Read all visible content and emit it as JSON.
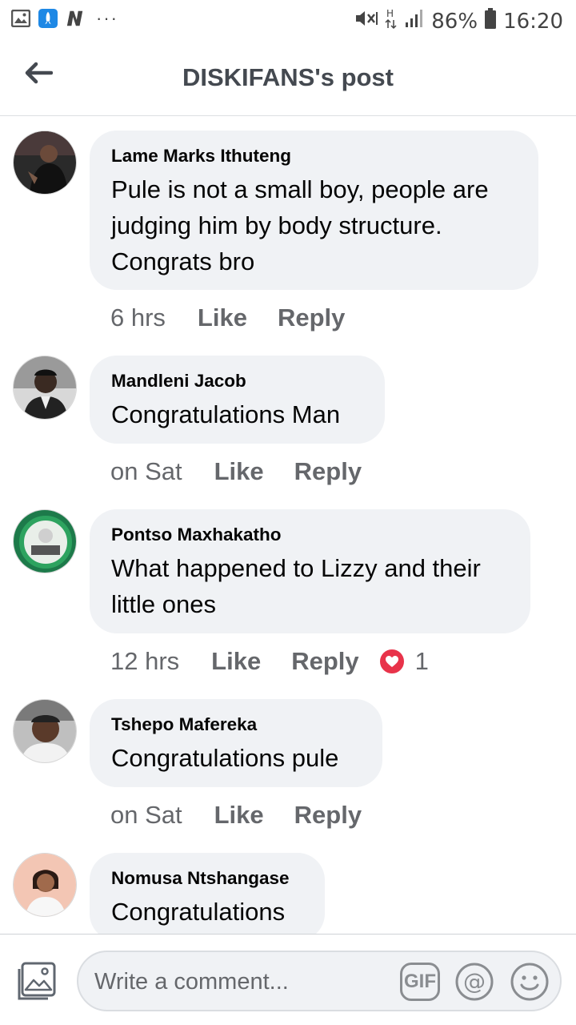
{
  "status_bar": {
    "left_icons": [
      "image-icon",
      "rocket-app-icon",
      "n-app-icon"
    ],
    "more": "···",
    "battery": "86%",
    "time": "16:20",
    "right_icons": [
      "mute-icon",
      "network-h-icon",
      "signal-icon",
      "battery-icon"
    ]
  },
  "header": {
    "title": "DISKIFANS's post",
    "back_icon": "arrow-left-icon"
  },
  "comments": [
    {
      "author": "Lame Marks Ithuteng",
      "text": "Pule is not a small boy, people are judging him by body structure. Congrats bro",
      "time": "6 hrs",
      "like": "Like",
      "reply": "Reply"
    },
    {
      "author": "Mandleni Jacob",
      "text": "Congratulations Man",
      "time": "on Sat",
      "like": "Like",
      "reply": "Reply"
    },
    {
      "author": "Pontso Maxhakatho",
      "text": "What happened to Lizzy and their little ones",
      "time": "12 hrs",
      "like": "Like",
      "reply": "Reply",
      "reaction": {
        "icon": "heart-icon",
        "count": "1",
        "color": "#e8334a"
      }
    },
    {
      "author": "Tshepo Mafereka",
      "text": "Congratulations pule",
      "time": "on Sat",
      "like": "Like",
      "reply": "Reply"
    },
    {
      "author": "Nomusa Ntshangase",
      "text": "Congratulations",
      "time": "",
      "like": "",
      "reply": ""
    }
  ],
  "composer": {
    "placeholder": "Write a comment...",
    "gif_label": "GIF",
    "icons": [
      "photo-icon",
      "gif-icon",
      "at-icon",
      "emoji-icon"
    ]
  },
  "colors": {
    "bubble": "#f0f2f5",
    "meta_text": "#65676b",
    "title_text": "#444950",
    "heart": "#e8334a"
  }
}
